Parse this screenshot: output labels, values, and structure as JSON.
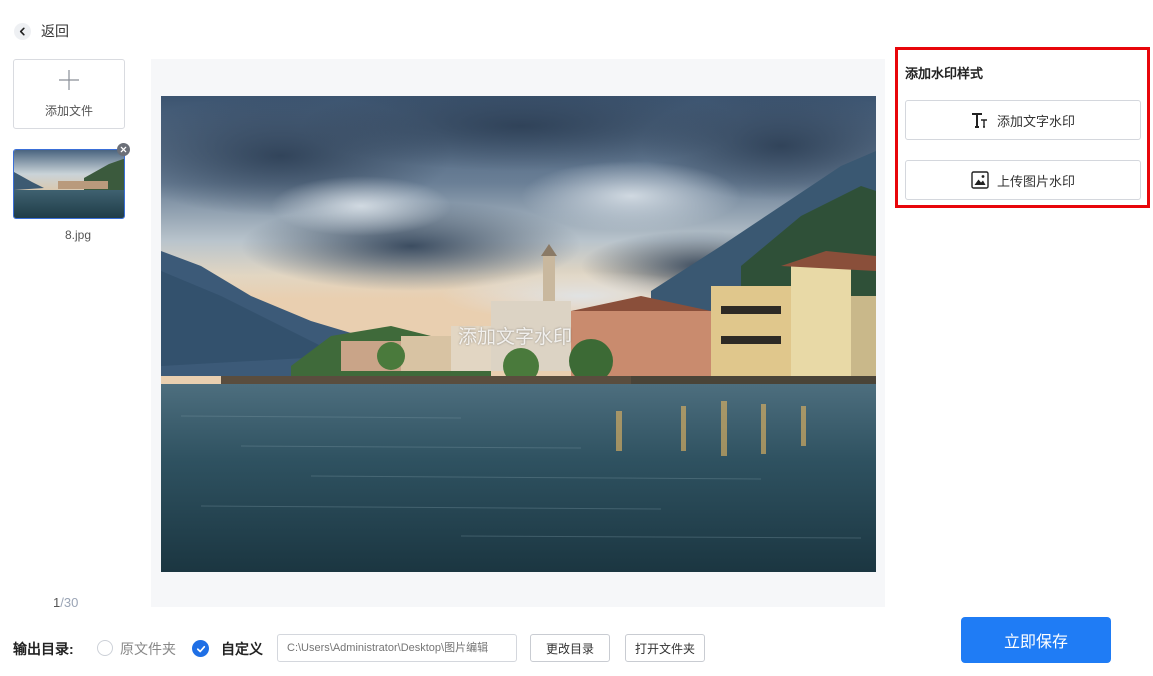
{
  "nav": {
    "back_label": "返回"
  },
  "files": {
    "add_label": "添加文件",
    "items": [
      {
        "name": "8.jpg"
      }
    ],
    "counter_current": "1",
    "counter_total": "/30"
  },
  "preview": {
    "watermark_text": "添加文字水印"
  },
  "watermark_panel": {
    "title": "添加水印样式",
    "text_button": "添加文字水印",
    "image_button": "上传图片水印",
    "highlight_color": "#e8060a"
  },
  "output": {
    "label": "输出目录:",
    "option_original": "原文件夹",
    "option_custom": "自定义",
    "selected": "自定义",
    "path_placeholder": "C:\\Users\\Administrator\\Desktop\\图片编辑",
    "change_dir_button": "更改目录",
    "open_folder_button": "打开文件夹",
    "save_button": "立即保存"
  },
  "colors": {
    "accent": "#1f7cf5",
    "checked": "#1f6fe5"
  }
}
